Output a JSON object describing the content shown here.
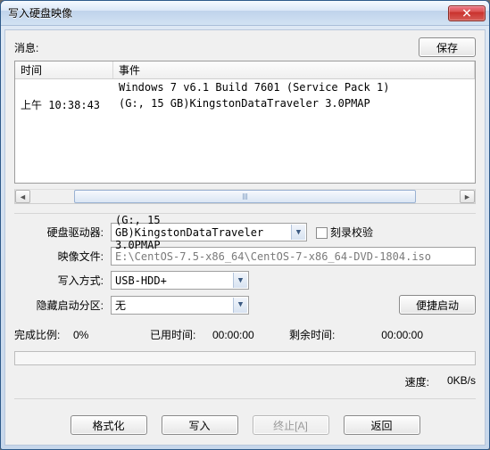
{
  "window": {
    "title": "写入硬盘映像"
  },
  "top": {
    "message_label": "消息:",
    "save_label": "保存"
  },
  "table": {
    "headers": {
      "time": "时间",
      "event": "事件"
    },
    "rows": [
      {
        "time": "",
        "event": "Windows 7 v6.1 Build 7601 (Service Pack 1)"
      },
      {
        "time": "上午 10:38:43",
        "event": "(G:, 15 GB)KingstonDataTraveler 3.0PMAP"
      }
    ]
  },
  "form": {
    "drive_label": "硬盘驱动器:",
    "drive_value": "(G:, 15 GB)KingstonDataTraveler 3.0PMAP",
    "verify_label": "刻录校验",
    "image_label": "映像文件:",
    "image_value": "E:\\CentOS-7.5-x86_64\\CentOS-7-x86_64-DVD-1804.iso",
    "method_label": "写入方式:",
    "method_value": "USB-HDD+",
    "hidden_label": "隐藏启动分区:",
    "hidden_value": "无",
    "boot_btn": "便捷启动"
  },
  "progress": {
    "pct_label": "完成比例:",
    "pct_value": "0%",
    "elapsed_label": "已用时间:",
    "elapsed_value": "00:00:00",
    "remain_label": "剩余时间:",
    "remain_value": "00:00:00",
    "speed_label": "速度:",
    "speed_value": "0KB/s"
  },
  "buttons": {
    "format": "格式化",
    "write": "写入",
    "abort": "终止[A]",
    "back": "返回"
  }
}
